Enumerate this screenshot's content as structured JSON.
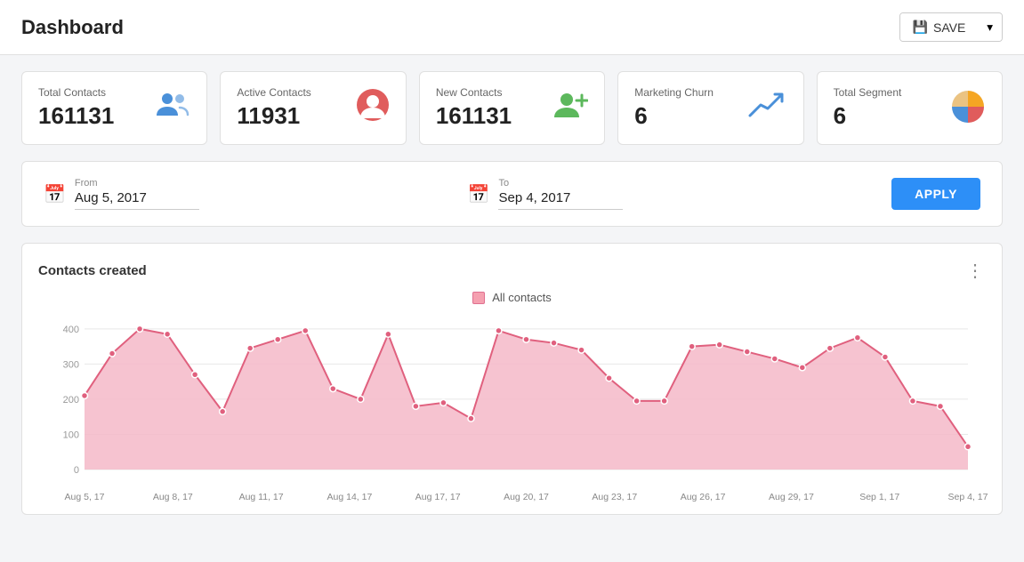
{
  "header": {
    "title": "Dashboard",
    "save_label": "SAVE"
  },
  "stats": [
    {
      "id": "total-contacts",
      "label": "Total Contacts",
      "value": "161131",
      "icon": "people-icon"
    },
    {
      "id": "active-contacts",
      "label": "Active Contacts",
      "value": "11931",
      "icon": "face-icon"
    },
    {
      "id": "new-contacts",
      "label": "New Contacts",
      "value": "161131",
      "icon": "add-person-icon"
    },
    {
      "id": "marketing-churn",
      "label": "Marketing Churn",
      "value": "6",
      "icon": "trending-up-icon"
    },
    {
      "id": "total-segment",
      "label": "Total Segment",
      "value": "6",
      "icon": "pie-chart-icon"
    }
  ],
  "date_filter": {
    "from_label": "From",
    "from_value": "Aug 5, 2017",
    "to_label": "To",
    "to_value": "Sep 4, 2017",
    "apply_label": "APPLY"
  },
  "chart": {
    "title": "Contacts created",
    "legend": "All contacts",
    "x_labels": [
      "Aug 5, 17",
      "Aug 8, 17",
      "Aug 11, 17",
      "Aug 14, 17",
      "Aug 17, 17",
      "Aug 20, 17",
      "Aug 23, 17",
      "Aug 26, 17",
      "Aug 29, 17",
      "Sep 1, 17",
      "Sep 4, 17"
    ],
    "y_labels": [
      "0",
      "100",
      "200",
      "300",
      "400"
    ],
    "data_points": [
      210,
      330,
      400,
      385,
      270,
      165,
      345,
      370,
      395,
      230,
      200,
      385,
      180,
      190,
      145,
      395,
      370,
      360,
      340,
      260,
      195,
      195,
      350,
      355,
      335,
      315,
      290,
      345,
      375,
      320,
      195,
      180,
      65
    ]
  }
}
